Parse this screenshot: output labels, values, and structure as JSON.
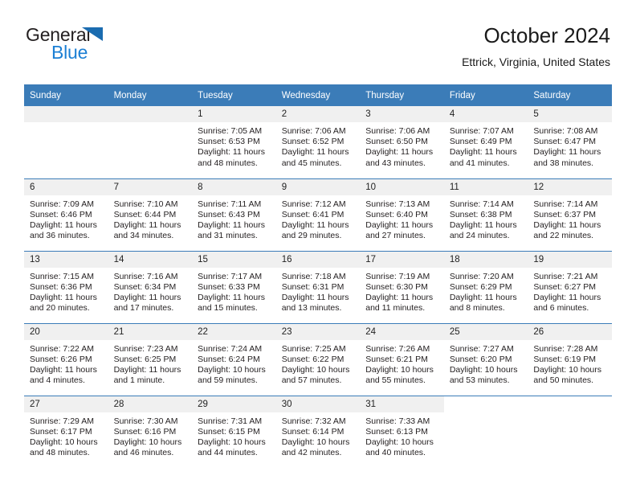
{
  "brand": {
    "name_top": "General",
    "name_bottom": "Blue",
    "triangle_icon": "triangle-icon",
    "colors": {
      "general_text": "#231f20",
      "blue_text": "#1b7fd4",
      "triangle": "#1b6cb0"
    }
  },
  "header": {
    "title": "October 2024",
    "subtitle": "Ettrick, Virginia, United States"
  },
  "theme": {
    "header_bg": "#3b7cb8",
    "header_text": "#ffffff",
    "daynum_bg": "#f0f0f0",
    "cell_bg": "#ffffff",
    "row_divider": "#3b7cb8"
  },
  "weekday_headers": [
    "Sunday",
    "Monday",
    "Tuesday",
    "Wednesday",
    "Thursday",
    "Friday",
    "Saturday"
  ],
  "weeks": [
    {
      "days": [
        {
          "num": "",
          "empty": true,
          "sunrise": "",
          "sunset": "",
          "daylight_1": "",
          "daylight_2": ""
        },
        {
          "num": "",
          "empty": true,
          "sunrise": "",
          "sunset": "",
          "daylight_1": "",
          "daylight_2": ""
        },
        {
          "num": "1",
          "empty": false,
          "sunrise": "Sunrise: 7:05 AM",
          "sunset": "Sunset: 6:53 PM",
          "daylight_1": "Daylight: 11 hours",
          "daylight_2": "and 48 minutes."
        },
        {
          "num": "2",
          "empty": false,
          "sunrise": "Sunrise: 7:06 AM",
          "sunset": "Sunset: 6:52 PM",
          "daylight_1": "Daylight: 11 hours",
          "daylight_2": "and 45 minutes."
        },
        {
          "num": "3",
          "empty": false,
          "sunrise": "Sunrise: 7:06 AM",
          "sunset": "Sunset: 6:50 PM",
          "daylight_1": "Daylight: 11 hours",
          "daylight_2": "and 43 minutes."
        },
        {
          "num": "4",
          "empty": false,
          "sunrise": "Sunrise: 7:07 AM",
          "sunset": "Sunset: 6:49 PM",
          "daylight_1": "Daylight: 11 hours",
          "daylight_2": "and 41 minutes."
        },
        {
          "num": "5",
          "empty": false,
          "sunrise": "Sunrise: 7:08 AM",
          "sunset": "Sunset: 6:47 PM",
          "daylight_1": "Daylight: 11 hours",
          "daylight_2": "and 38 minutes."
        }
      ]
    },
    {
      "days": [
        {
          "num": "6",
          "empty": false,
          "sunrise": "Sunrise: 7:09 AM",
          "sunset": "Sunset: 6:46 PM",
          "daylight_1": "Daylight: 11 hours",
          "daylight_2": "and 36 minutes."
        },
        {
          "num": "7",
          "empty": false,
          "sunrise": "Sunrise: 7:10 AM",
          "sunset": "Sunset: 6:44 PM",
          "daylight_1": "Daylight: 11 hours",
          "daylight_2": "and 34 minutes."
        },
        {
          "num": "8",
          "empty": false,
          "sunrise": "Sunrise: 7:11 AM",
          "sunset": "Sunset: 6:43 PM",
          "daylight_1": "Daylight: 11 hours",
          "daylight_2": "and 31 minutes."
        },
        {
          "num": "9",
          "empty": false,
          "sunrise": "Sunrise: 7:12 AM",
          "sunset": "Sunset: 6:41 PM",
          "daylight_1": "Daylight: 11 hours",
          "daylight_2": "and 29 minutes."
        },
        {
          "num": "10",
          "empty": false,
          "sunrise": "Sunrise: 7:13 AM",
          "sunset": "Sunset: 6:40 PM",
          "daylight_1": "Daylight: 11 hours",
          "daylight_2": "and 27 minutes."
        },
        {
          "num": "11",
          "empty": false,
          "sunrise": "Sunrise: 7:14 AM",
          "sunset": "Sunset: 6:38 PM",
          "daylight_1": "Daylight: 11 hours",
          "daylight_2": "and 24 minutes."
        },
        {
          "num": "12",
          "empty": false,
          "sunrise": "Sunrise: 7:14 AM",
          "sunset": "Sunset: 6:37 PM",
          "daylight_1": "Daylight: 11 hours",
          "daylight_2": "and 22 minutes."
        }
      ]
    },
    {
      "days": [
        {
          "num": "13",
          "empty": false,
          "sunrise": "Sunrise: 7:15 AM",
          "sunset": "Sunset: 6:36 PM",
          "daylight_1": "Daylight: 11 hours",
          "daylight_2": "and 20 minutes."
        },
        {
          "num": "14",
          "empty": false,
          "sunrise": "Sunrise: 7:16 AM",
          "sunset": "Sunset: 6:34 PM",
          "daylight_1": "Daylight: 11 hours",
          "daylight_2": "and 17 minutes."
        },
        {
          "num": "15",
          "empty": false,
          "sunrise": "Sunrise: 7:17 AM",
          "sunset": "Sunset: 6:33 PM",
          "daylight_1": "Daylight: 11 hours",
          "daylight_2": "and 15 minutes."
        },
        {
          "num": "16",
          "empty": false,
          "sunrise": "Sunrise: 7:18 AM",
          "sunset": "Sunset: 6:31 PM",
          "daylight_1": "Daylight: 11 hours",
          "daylight_2": "and 13 minutes."
        },
        {
          "num": "17",
          "empty": false,
          "sunrise": "Sunrise: 7:19 AM",
          "sunset": "Sunset: 6:30 PM",
          "daylight_1": "Daylight: 11 hours",
          "daylight_2": "and 11 minutes."
        },
        {
          "num": "18",
          "empty": false,
          "sunrise": "Sunrise: 7:20 AM",
          "sunset": "Sunset: 6:29 PM",
          "daylight_1": "Daylight: 11 hours",
          "daylight_2": "and 8 minutes."
        },
        {
          "num": "19",
          "empty": false,
          "sunrise": "Sunrise: 7:21 AM",
          "sunset": "Sunset: 6:27 PM",
          "daylight_1": "Daylight: 11 hours",
          "daylight_2": "and 6 minutes."
        }
      ]
    },
    {
      "days": [
        {
          "num": "20",
          "empty": false,
          "sunrise": "Sunrise: 7:22 AM",
          "sunset": "Sunset: 6:26 PM",
          "daylight_1": "Daylight: 11 hours",
          "daylight_2": "and 4 minutes."
        },
        {
          "num": "21",
          "empty": false,
          "sunrise": "Sunrise: 7:23 AM",
          "sunset": "Sunset: 6:25 PM",
          "daylight_1": "Daylight: 11 hours",
          "daylight_2": "and 1 minute."
        },
        {
          "num": "22",
          "empty": false,
          "sunrise": "Sunrise: 7:24 AM",
          "sunset": "Sunset: 6:24 PM",
          "daylight_1": "Daylight: 10 hours",
          "daylight_2": "and 59 minutes."
        },
        {
          "num": "23",
          "empty": false,
          "sunrise": "Sunrise: 7:25 AM",
          "sunset": "Sunset: 6:22 PM",
          "daylight_1": "Daylight: 10 hours",
          "daylight_2": "and 57 minutes."
        },
        {
          "num": "24",
          "empty": false,
          "sunrise": "Sunrise: 7:26 AM",
          "sunset": "Sunset: 6:21 PM",
          "daylight_1": "Daylight: 10 hours",
          "daylight_2": "and 55 minutes."
        },
        {
          "num": "25",
          "empty": false,
          "sunrise": "Sunrise: 7:27 AM",
          "sunset": "Sunset: 6:20 PM",
          "daylight_1": "Daylight: 10 hours",
          "daylight_2": "and 53 minutes."
        },
        {
          "num": "26",
          "empty": false,
          "sunrise": "Sunrise: 7:28 AM",
          "sunset": "Sunset: 6:19 PM",
          "daylight_1": "Daylight: 10 hours",
          "daylight_2": "and 50 minutes."
        }
      ]
    },
    {
      "days": [
        {
          "num": "27",
          "empty": false,
          "sunrise": "Sunrise: 7:29 AM",
          "sunset": "Sunset: 6:17 PM",
          "daylight_1": "Daylight: 10 hours",
          "daylight_2": "and 48 minutes."
        },
        {
          "num": "28",
          "empty": false,
          "sunrise": "Sunrise: 7:30 AM",
          "sunset": "Sunset: 6:16 PM",
          "daylight_1": "Daylight: 10 hours",
          "daylight_2": "and 46 minutes."
        },
        {
          "num": "29",
          "empty": false,
          "sunrise": "Sunrise: 7:31 AM",
          "sunset": "Sunset: 6:15 PM",
          "daylight_1": "Daylight: 10 hours",
          "daylight_2": "and 44 minutes."
        },
        {
          "num": "30",
          "empty": false,
          "sunrise": "Sunrise: 7:32 AM",
          "sunset": "Sunset: 6:14 PM",
          "daylight_1": "Daylight: 10 hours",
          "daylight_2": "and 42 minutes."
        },
        {
          "num": "31",
          "empty": false,
          "sunrise": "Sunrise: 7:33 AM",
          "sunset": "Sunset: 6:13 PM",
          "daylight_1": "Daylight: 10 hours",
          "daylight_2": "and 40 minutes."
        },
        {
          "num": "",
          "empty": true,
          "blank": true,
          "sunrise": "",
          "sunset": "",
          "daylight_1": "",
          "daylight_2": ""
        },
        {
          "num": "",
          "empty": true,
          "blank": true,
          "sunrise": "",
          "sunset": "",
          "daylight_1": "",
          "daylight_2": ""
        }
      ]
    }
  ]
}
